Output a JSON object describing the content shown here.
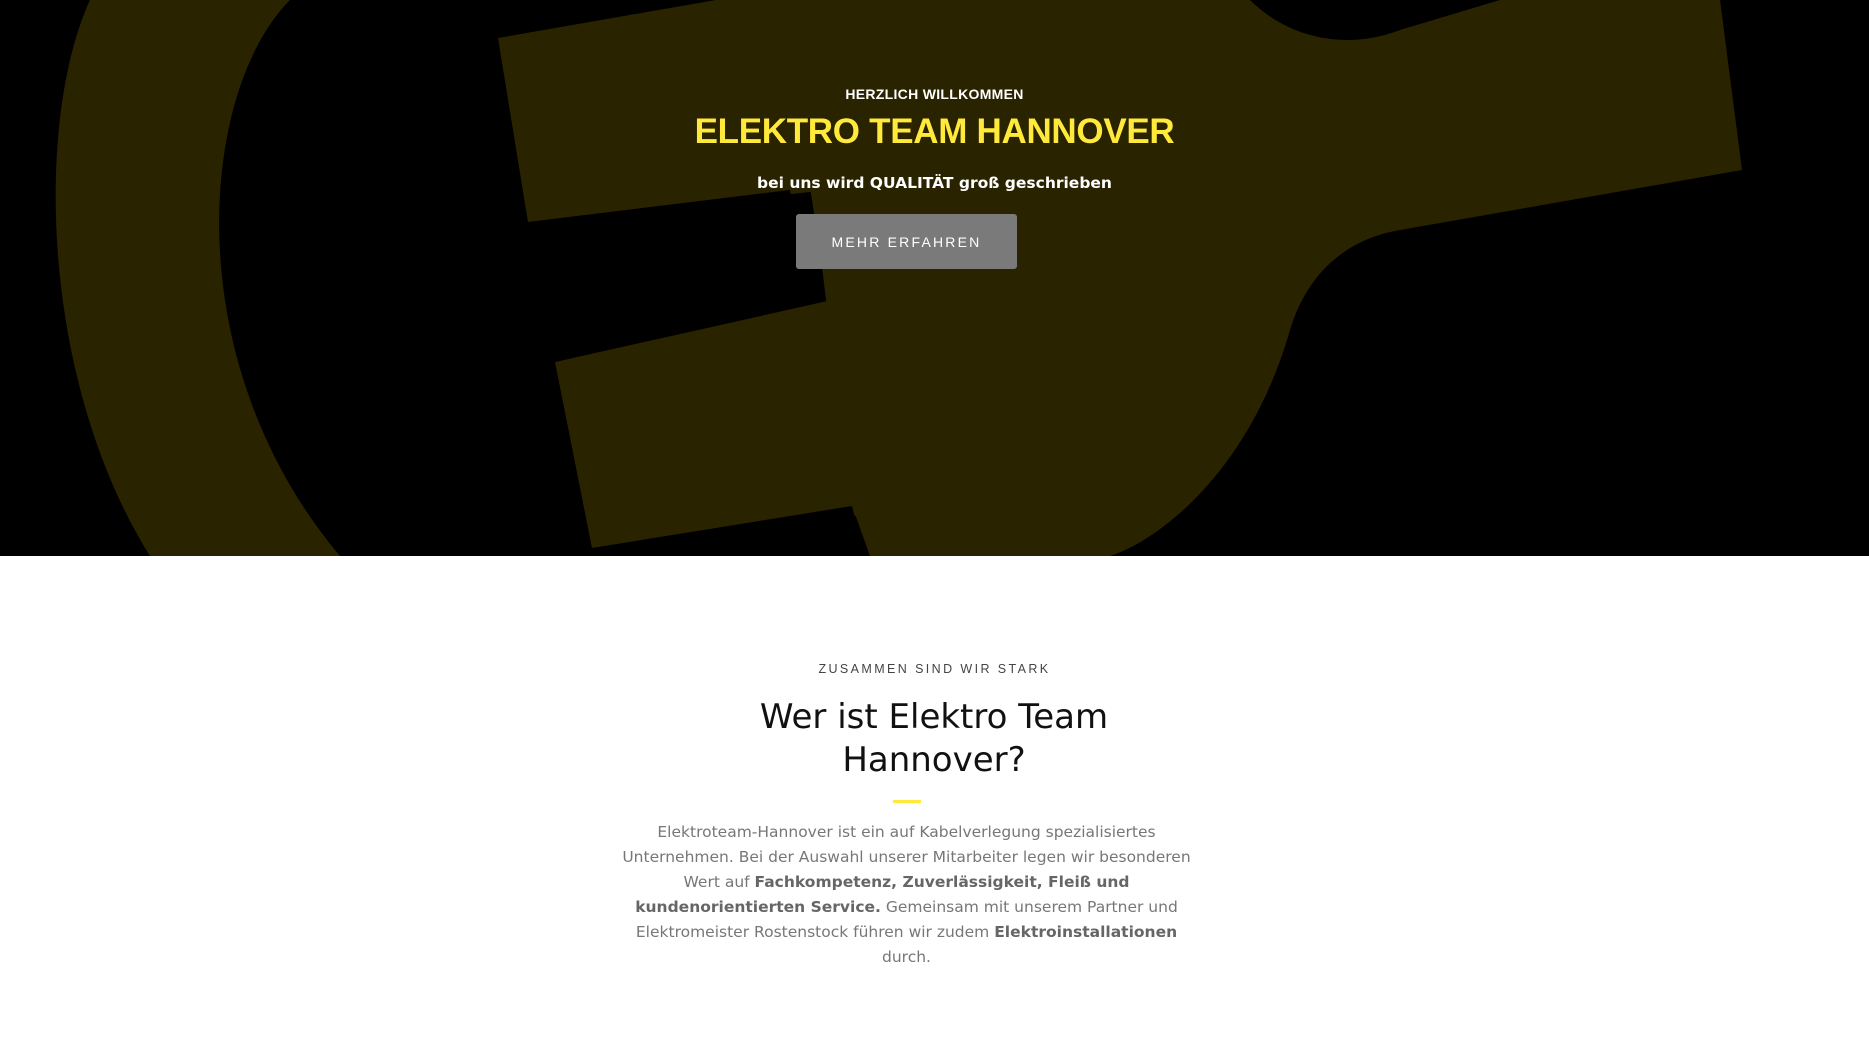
{
  "colors": {
    "accent": "#ffe93a",
    "hero_background": "#000000",
    "hero_logo_shape": "#2a2300",
    "button_background": "#7a7a7a",
    "text_body": "#777777",
    "text_heading": "#111111"
  },
  "hero": {
    "eyebrow": "HERZLICH WILLKOMMEN",
    "title": "ELEKTRO TEAM HANNOVER",
    "subtitle": "bei uns wird QUALITÄT groß geschrieben",
    "cta_label": "MEHR ERFAHREN",
    "background_icon": "plug-logo-icon"
  },
  "about": {
    "kicker": "ZUSAMMEN SIND WIR STARK",
    "heading": "Wer ist Elektro Team Hannover?",
    "paragraph": {
      "part1": "Elektroteam-Hannover ist ein auf Kabelverlegung spezialisiertes Unternehmen. Bei der Auswahl unserer Mitarbeiter legen wir besonderen Wert auf ",
      "bold1": "Fachkompetenz, Zuverlässigkeit, Fleiß und kundenorientierten Service.",
      "part2": " Gemeinsam mit unserem Partner und Elektromeister Rostenstock führen wir zudem ",
      "bold2": "Elektroinstallationen",
      "part3": " durch."
    }
  }
}
